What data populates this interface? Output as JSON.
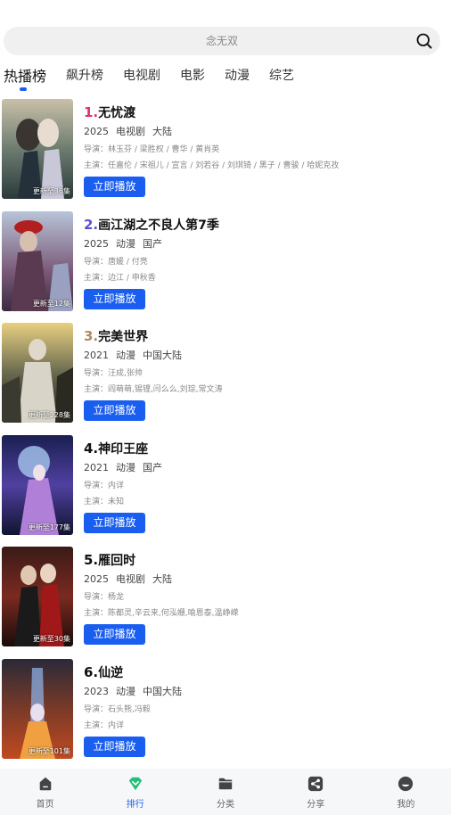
{
  "search": {
    "placeholder": "念无双"
  },
  "tabs": [
    "热播榜",
    "飙升榜",
    "电视剧",
    "电影",
    "动漫",
    "综艺"
  ],
  "colors": {
    "accent": "#1a5ef0",
    "rank1": "#e0306a",
    "rank2": "#5b4fd8",
    "rank3": "#b08a60"
  },
  "list": [
    {
      "rank": "1.",
      "title": "无忧渡",
      "year": "2025",
      "type": "电视剧",
      "region": "大陆",
      "director": "导演：林玉芬 / 梁胜权 / 曹华 / 黄肖英",
      "cast": "主演：任嘉伦 / 宋祖儿 / 宣言 / 刘若谷 / 刘琪锜 / 黑子 / 曹骏 / 哈妮克孜",
      "update": "更新至36集",
      "play": "立即播放"
    },
    {
      "rank": "2.",
      "title": "画江湖之不良人第7季",
      "year": "2025",
      "type": "动漫",
      "region": "国产",
      "director": "导演：唐媛 / 付亮",
      "cast": "主演：边江 / 申秋香",
      "update": "更新至12集",
      "play": "立即播放"
    },
    {
      "rank": "3.",
      "title": "完美世界",
      "year": "2021",
      "type": "动漫",
      "region": "中国大陆",
      "director": "导演：汪成,张帅",
      "cast": "主演：阎萌萌,锡锂,闫么么,刘琮,常文涛",
      "update": "更新至228集",
      "play": "立即播放"
    },
    {
      "rank": "4.",
      "title": "神印王座",
      "year": "2021",
      "type": "动漫",
      "region": "国产",
      "director": "导演：内详",
      "cast": "主演：未知",
      "update": "更新至177集",
      "play": "立即播放"
    },
    {
      "rank": "5.",
      "title": "雁回时",
      "year": "2025",
      "type": "电视剧",
      "region": "大陆",
      "director": "导演：杨龙",
      "cast": "主演：陈都灵,辛云来,何泓姗,喻恩泰,温峥嵘",
      "update": "更新至30集",
      "play": "立即播放"
    },
    {
      "rank": "6.",
      "title": "仙逆",
      "year": "2023",
      "type": "动漫",
      "region": "中国大陆",
      "director": "导演：石头熊,冯毅",
      "cast": "主演：内详",
      "update": "更新至101集",
      "play": "立即播放"
    }
  ],
  "nav": [
    {
      "label": "首页",
      "icon": "home-icon"
    },
    {
      "label": "排行",
      "icon": "ranking-icon"
    },
    {
      "label": "分类",
      "icon": "folder-icon"
    },
    {
      "label": "分享",
      "icon": "share-icon"
    },
    {
      "label": "我的",
      "icon": "profile-icon"
    }
  ]
}
